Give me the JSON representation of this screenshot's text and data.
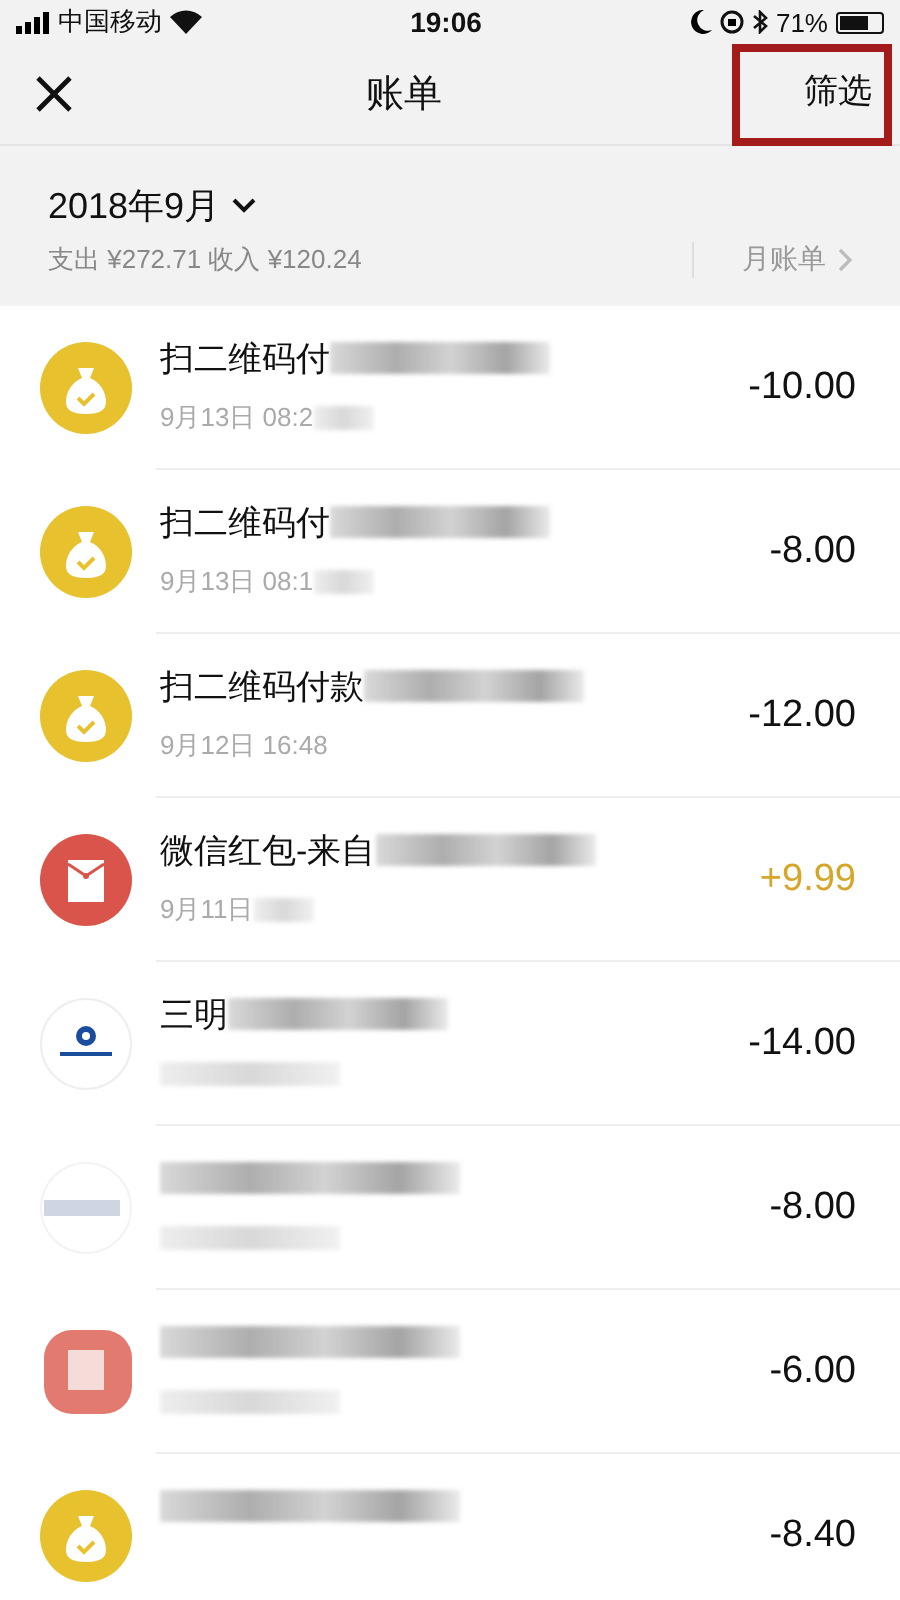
{
  "status_bar": {
    "carrier": "中国移动",
    "time": "19:06",
    "battery": "71%"
  },
  "nav": {
    "title": "账单",
    "filter": "筛选",
    "filter_highlighted": true
  },
  "summary": {
    "month": "2018年9月",
    "totals": "支出 ¥272.71 收入 ¥120.24",
    "monthly_bill": "月账单"
  },
  "transactions": [
    {
      "kind": "moneybag",
      "title": "扫二维码付",
      "title_redacted": true,
      "date": "9月13日 08:2",
      "date_redacted": true,
      "amount": "-10.00",
      "income": false
    },
    {
      "kind": "moneybag",
      "title": "扫二维码付",
      "title_redacted": true,
      "date": "9月13日 08:1",
      "date_redacted": true,
      "amount": "-8.00",
      "income": false
    },
    {
      "kind": "moneybag",
      "title": "扫二维码付款",
      "title_redacted": true,
      "date": "9月12日 16:48",
      "date_redacted": false,
      "amount": "-12.00",
      "income": false
    },
    {
      "kind": "redpacket",
      "title": "微信红包-来自",
      "title_redacted": true,
      "date": "9月11日",
      "date_redacted": true,
      "amount": "+9.99",
      "income": true
    },
    {
      "kind": "bank",
      "title": "三明",
      "title_redacted": true,
      "date_redacted": true,
      "amount": "-14.00",
      "income": false
    },
    {
      "kind": "blurred",
      "title_redacted": true,
      "date_redacted": true,
      "amount": "-8.00",
      "income": false
    },
    {
      "kind": "redpacket_blurred",
      "title_redacted": true,
      "date_redacted": true,
      "amount": "-6.00",
      "income": false
    },
    {
      "kind": "moneybag",
      "title_redacted": true,
      "date_redacted": false,
      "amount": "-8.40",
      "income": false
    }
  ]
}
